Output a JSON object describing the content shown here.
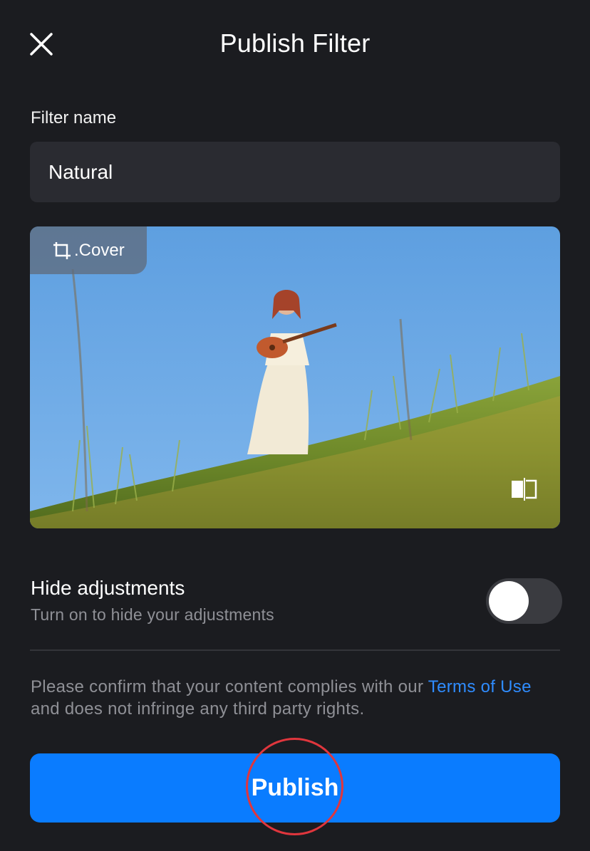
{
  "header": {
    "title": "Publish Filter",
    "close_icon": "close-icon"
  },
  "filter_name": {
    "label": "Filter name",
    "value": "Natural"
  },
  "preview": {
    "cover_label": "Cover",
    "cover_icon": "crop-icon",
    "compare_icon": "compare-icon",
    "image_description_icon": "photo-preview"
  },
  "hide_adjustments": {
    "title": "Hide adjustments",
    "subtitle": "Turn on to hide your adjustments",
    "enabled": false
  },
  "legal": {
    "text_before": "Please confirm that your content complies with our ",
    "link": "Terms of Use",
    "text_after": " and does not infringe any third party rights."
  },
  "publish": {
    "label": "Publish"
  },
  "colors": {
    "background": "#1b1c20",
    "input_bg": "#2a2b31",
    "accent": "#0a7cff",
    "link": "#2f8cff",
    "muted_text": "#8f9096",
    "highlight": "#e0363d"
  }
}
